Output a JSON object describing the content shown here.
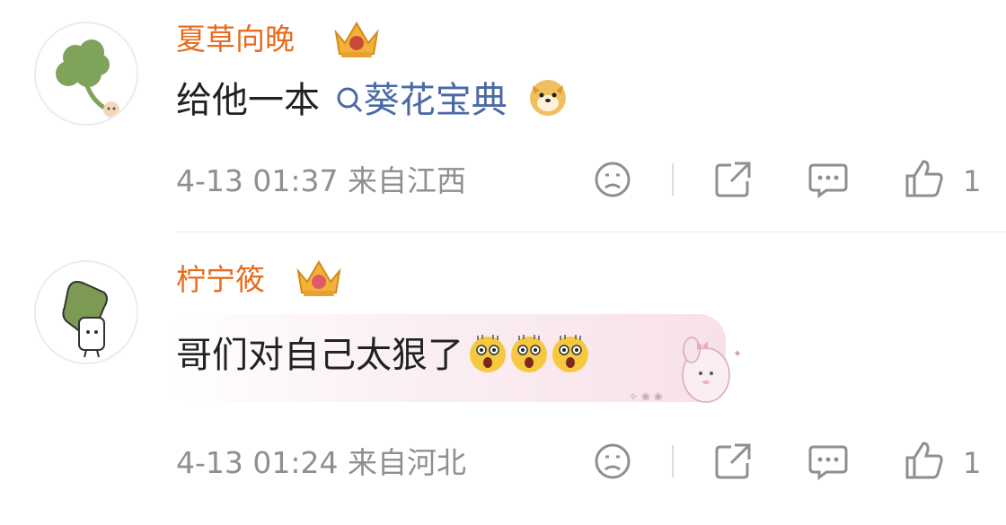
{
  "comments": [
    {
      "username": "夏草向晚",
      "text_prefix": "给他一本",
      "topic": "葵花宝典",
      "meta": "4-13 01:37  来自江西",
      "like_count": "1",
      "icons": {
        "avatar": "clover-avatar",
        "badge": "crown-badge",
        "emoji": "doge-emoji"
      }
    },
    {
      "username": "柠宁筱",
      "text": "哥们对自己太狠了",
      "meta": "4-13 01:24  来自河北",
      "like_count": "1",
      "icons": {
        "avatar": "green-character-avatar",
        "badge": "crown-badge",
        "emoji": "shocked-emoji",
        "sticker": "pink-bunny-sticker"
      }
    }
  ],
  "colors": {
    "username": "#e86b1e",
    "topic": "#4a6aa6",
    "meta": "#8f8f8f",
    "text": "#222222"
  }
}
